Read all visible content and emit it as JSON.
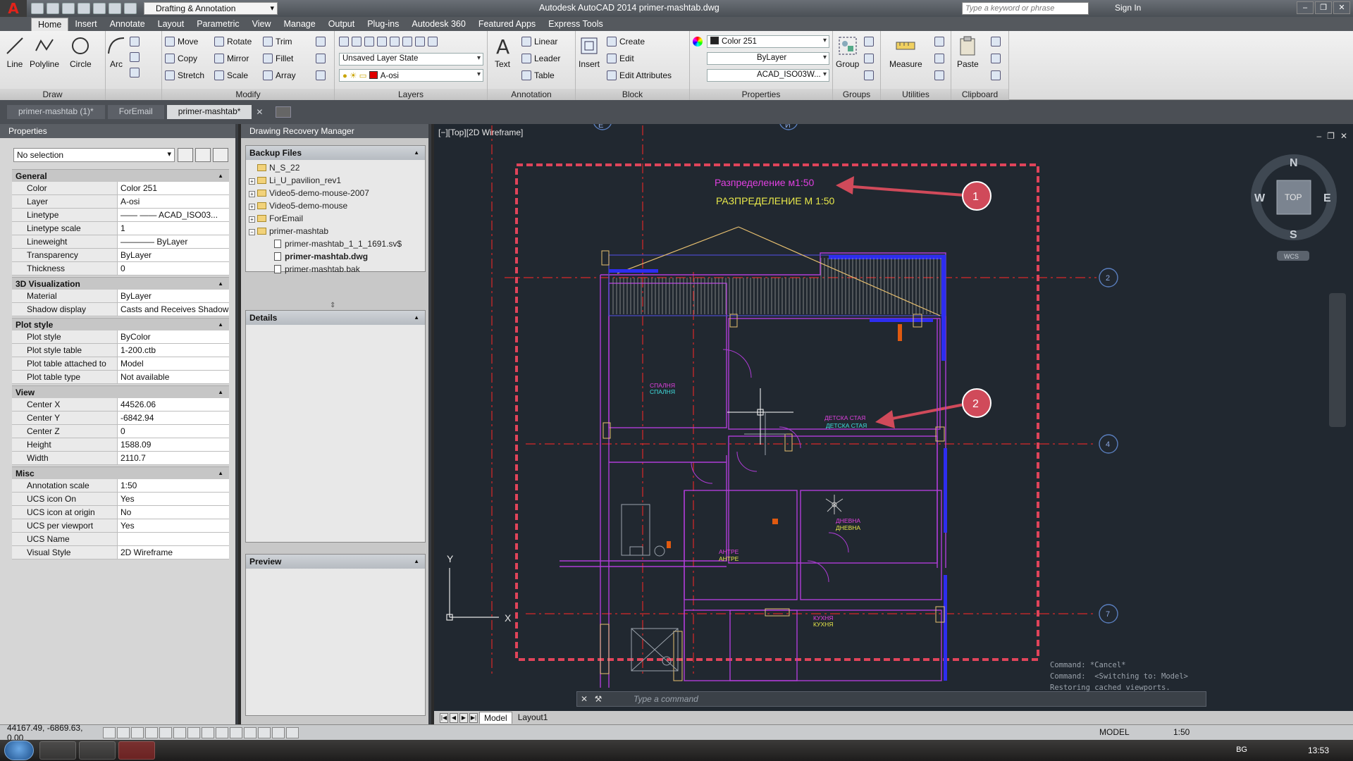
{
  "titlebar": {
    "workspace": "Drafting & Annotation",
    "title": "Autodesk AutoCAD 2014    primer-mashtab.dwg",
    "search_placeholder": "Type a keyword or phrase",
    "signin": "Sign In"
  },
  "ribbon_tabs": [
    "Home",
    "Insert",
    "Annotate",
    "Layout",
    "Parametric",
    "View",
    "Manage",
    "Output",
    "Plug-ins",
    "Autodesk 360",
    "Featured Apps",
    "Express Tools"
  ],
  "ribbon": {
    "draw": {
      "title": "Draw",
      "line": "Line",
      "polyline": "Polyline",
      "circle": "Circle",
      "arc": "Arc"
    },
    "modify": {
      "title": "Modify",
      "move": "Move",
      "rotate": "Rotate",
      "trim": "Trim",
      "copy": "Copy",
      "mirror": "Mirror",
      "fillet": "Fillet",
      "stretch": "Stretch",
      "scale": "Scale",
      "array": "Array"
    },
    "layers": {
      "title": "Layers",
      "layer_state": "Unsaved Layer State",
      "current_layer": "A-osi"
    },
    "annotation": {
      "title": "Annotation",
      "text": "Text",
      "linear": "Linear",
      "leader": "Leader",
      "table": "Table"
    },
    "block": {
      "title": "Block",
      "insert": "Insert",
      "create": "Create",
      "edit": "Edit",
      "edit_attributes": "Edit Attributes"
    },
    "properties": {
      "title": "Properties",
      "color": "Color 251",
      "lineweight": "ByLayer",
      "linetype": "ACAD_ISO03W..."
    },
    "groups": {
      "title": "Groups",
      "group": "Group"
    },
    "utilities": {
      "title": "Utilities",
      "measure": "Measure"
    },
    "clipboard": {
      "title": "Clipboard",
      "paste": "Paste"
    }
  },
  "doc_tabs": [
    "primer-mashtab (1)*",
    "ForEmail",
    "primer-mashtab*"
  ],
  "properties_palette": {
    "title": "Properties",
    "selection": "No selection",
    "categories": [
      {
        "name": "General",
        "rows": [
          [
            "Color",
            "Color 251"
          ],
          [
            "Layer",
            "A-osi"
          ],
          [
            "Linetype",
            "—— —— ACAD_ISO03..."
          ],
          [
            "Linetype scale",
            "1"
          ],
          [
            "Lineweight",
            "———— ByLayer"
          ],
          [
            "Transparency",
            "ByLayer"
          ],
          [
            "Thickness",
            "0"
          ]
        ]
      },
      {
        "name": "3D Visualization",
        "rows": [
          [
            "Material",
            "ByLayer"
          ],
          [
            "Shadow display",
            "Casts and Receives Shadows"
          ]
        ]
      },
      {
        "name": "Plot style",
        "rows": [
          [
            "Plot style",
            "ByColor"
          ],
          [
            "Plot style table",
            "1-200.ctb"
          ],
          [
            "Plot table attached to",
            "Model"
          ],
          [
            "Plot table type",
            "Not available"
          ]
        ]
      },
      {
        "name": "View",
        "rows": [
          [
            "Center X",
            "44526.06"
          ],
          [
            "Center Y",
            "-6842.94"
          ],
          [
            "Center Z",
            "0"
          ],
          [
            "Height",
            "1588.09"
          ],
          [
            "Width",
            "2110.7"
          ]
        ]
      },
      {
        "name": "Misc",
        "rows": [
          [
            "Annotation scale",
            "1:50"
          ],
          [
            "UCS icon On",
            "Yes"
          ],
          [
            "UCS icon at origin",
            "No"
          ],
          [
            "UCS per viewport",
            "Yes"
          ],
          [
            "UCS Name",
            ""
          ],
          [
            "Visual Style",
            "2D Wireframe"
          ]
        ]
      }
    ]
  },
  "recovery": {
    "title": "Drawing Recovery Manager",
    "backup_header": "Backup Files",
    "tree": [
      "N_S_22",
      "Li_U_pavilion_rev1",
      "Video5-demo-mouse-2007",
      "Video5-demo-mouse",
      "ForEmail",
      "primer-mashtab"
    ],
    "files": [
      "primer-mashtab_1_1_1691.sv$",
      "primer-mashtab.dwg",
      "primer-mashtab.bak"
    ],
    "details": "Details",
    "preview": "Preview"
  },
  "viewport": {
    "label": "[−][Top][2D Wireframe]",
    "compass": {
      "n": "N",
      "s": "S",
      "e": "E",
      "w": "W",
      "top": "TOP",
      "wcs": "WCS"
    },
    "grid_labels": {
      "e": "E",
      "i": "И",
      "g2": "2",
      "g4": "4",
      "g7": "7"
    },
    "annotations": {
      "c1": "1",
      "c2": "2"
    },
    "text_magenta": "Разпределение м1:50",
    "text_yellow": "РАЗПРЕДЕЛЕНИЕ М  1:50",
    "rooms": [
      {
        "a": "СПАЛНЯ",
        "b": "СПАЛНЯ"
      },
      {
        "a": "ДЕТСКА СТАЯ",
        "b": "ДЕТСКА СТАЯ"
      },
      {
        "a": "ДНЕВНА",
        "b": "ДНЕВНА"
      },
      {
        "a": "АНТРЕ",
        "b": "АНТРЕ"
      },
      {
        "a": "КУХНЯ",
        "b": "КУХНЯ"
      }
    ],
    "ucs": {
      "x": "X",
      "y": "Y"
    },
    "command_history": [
      "Command: *Cancel*",
      "Command:  <Switching to: Model>",
      "Restoring cached viewports."
    ],
    "command_placeholder": "Type a command"
  },
  "layout_tabs": [
    "Model",
    "Layout1"
  ],
  "status": {
    "coords": "44167.49, -6869.63, 0.00",
    "model": "MODEL",
    "scale": "1:50"
  },
  "taskbar": {
    "lang": "BG",
    "clock": "13:53"
  }
}
